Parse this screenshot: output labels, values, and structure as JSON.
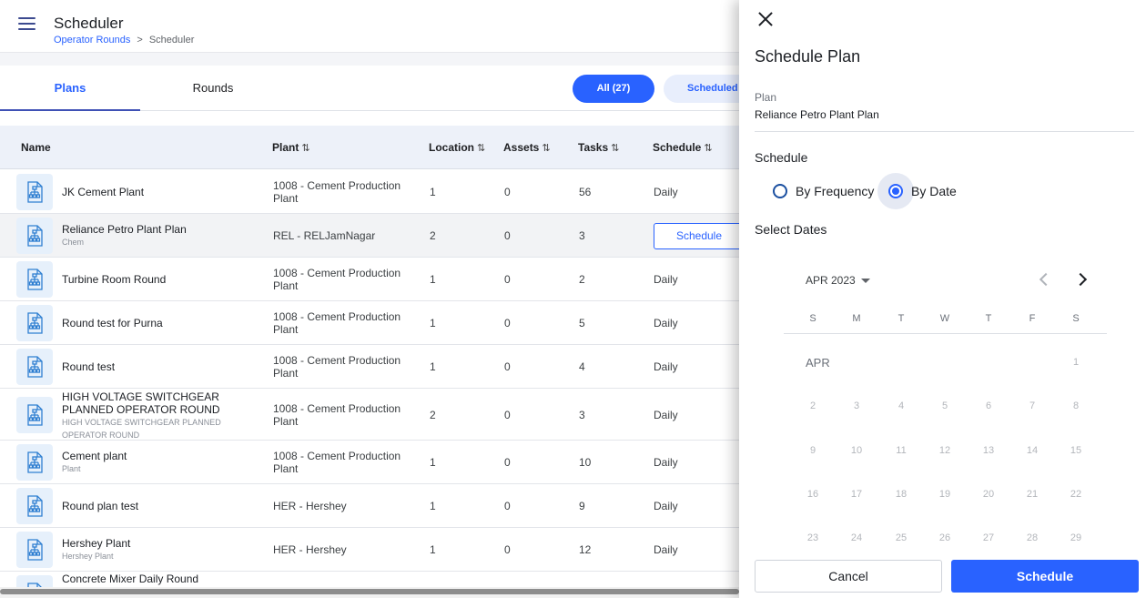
{
  "header": {
    "title": "Scheduler",
    "breadcrumb": {
      "parent": "Operator Rounds",
      "separator": ">",
      "current": "Scheduler"
    }
  },
  "tabs": [
    {
      "label": "Plans",
      "active": true
    },
    {
      "label": "Rounds",
      "active": false
    }
  ],
  "filters": [
    {
      "label": "All (27)",
      "active": true
    },
    {
      "label": "Scheduled (",
      "active": false
    }
  ],
  "table": {
    "columns": [
      "Name",
      "Plant",
      "Location",
      "Assets",
      "Tasks",
      "Schedule"
    ],
    "sort_icon": "⇅",
    "rows": [
      {
        "name": "JK Cement Plant",
        "sub": "",
        "plant": "1008 - Cement Production Plant",
        "location": "1",
        "assets": "0",
        "tasks": "56",
        "schedule": "Daily"
      },
      {
        "name": "Reliance Petro Plant Plan",
        "sub": "Chem",
        "plant": "REL - RELJamNagar",
        "location": "2",
        "assets": "0",
        "tasks": "3",
        "schedule": "Schedule"
      },
      {
        "name": "Turbine Room Round",
        "sub": "",
        "plant": "1008 - Cement Production Plant",
        "location": "1",
        "assets": "0",
        "tasks": "2",
        "schedule": "Daily"
      },
      {
        "name": "Round test for Purna",
        "sub": "",
        "plant": "1008 - Cement Production Plant",
        "location": "1",
        "assets": "0",
        "tasks": "5",
        "schedule": "Daily"
      },
      {
        "name": "Round test",
        "sub": "",
        "plant": "1008 - Cement Production Plant",
        "location": "1",
        "assets": "0",
        "tasks": "4",
        "schedule": "Daily"
      },
      {
        "name": "HIGH VOLTAGE SWITCHGEAR PLANNED OPERATOR ROUND",
        "sub": "HIGH VOLTAGE SWITCHGEAR PLANNED OPERATOR ROUND",
        "plant": "1008 - Cement Production Plant",
        "location": "2",
        "assets": "0",
        "tasks": "3",
        "schedule": "Daily"
      },
      {
        "name": "Cement plant",
        "sub": "Plant",
        "plant": "1008 - Cement Production Plant",
        "location": "1",
        "assets": "0",
        "tasks": "10",
        "schedule": "Daily"
      },
      {
        "name": "Round plan test",
        "sub": "",
        "plant": "HER - Hershey",
        "location": "1",
        "assets": "0",
        "tasks": "9",
        "schedule": "Daily"
      },
      {
        "name": "Hershey Plant",
        "sub": "Hershey Plant",
        "plant": "HER - Hershey",
        "location": "1",
        "assets": "0",
        "tasks": "12",
        "schedule": "Daily"
      },
      {
        "name": "Concrete Mixer Daily Round",
        "sub": "",
        "plant": "",
        "location": "",
        "assets": "",
        "tasks": "",
        "schedule": ""
      }
    ]
  },
  "drawer": {
    "title": "Schedule Plan",
    "plan_label": "Plan",
    "plan_value": "Reliance Petro Plant Plan",
    "schedule_label": "Schedule",
    "options": [
      {
        "label": "By Frequency",
        "selected": false
      },
      {
        "label": "By Date",
        "selected": true
      }
    ],
    "select_dates_label": "Select Dates",
    "calendar": {
      "month_selector": "APR 2023",
      "month_label": "APR",
      "weekdays": [
        "S",
        "M",
        "T",
        "W",
        "T",
        "F",
        "S"
      ],
      "weeks": [
        [
          "",
          "",
          "",
          "",
          "",
          "",
          "1"
        ],
        [
          "2",
          "3",
          "4",
          "5",
          "6",
          "7",
          "8"
        ],
        [
          "9",
          "10",
          "11",
          "12",
          "13",
          "14",
          "15"
        ],
        [
          "16",
          "17",
          "18",
          "19",
          "20",
          "21",
          "22"
        ],
        [
          "23",
          "24",
          "25",
          "26",
          "27",
          "28",
          "29"
        ]
      ]
    },
    "cancel_label": "Cancel",
    "schedule_button_label": "Schedule"
  },
  "colors": {
    "accent": "#2962ff",
    "header_bg": "#edf1f9",
    "icon_bg": "#e6f0fb"
  }
}
